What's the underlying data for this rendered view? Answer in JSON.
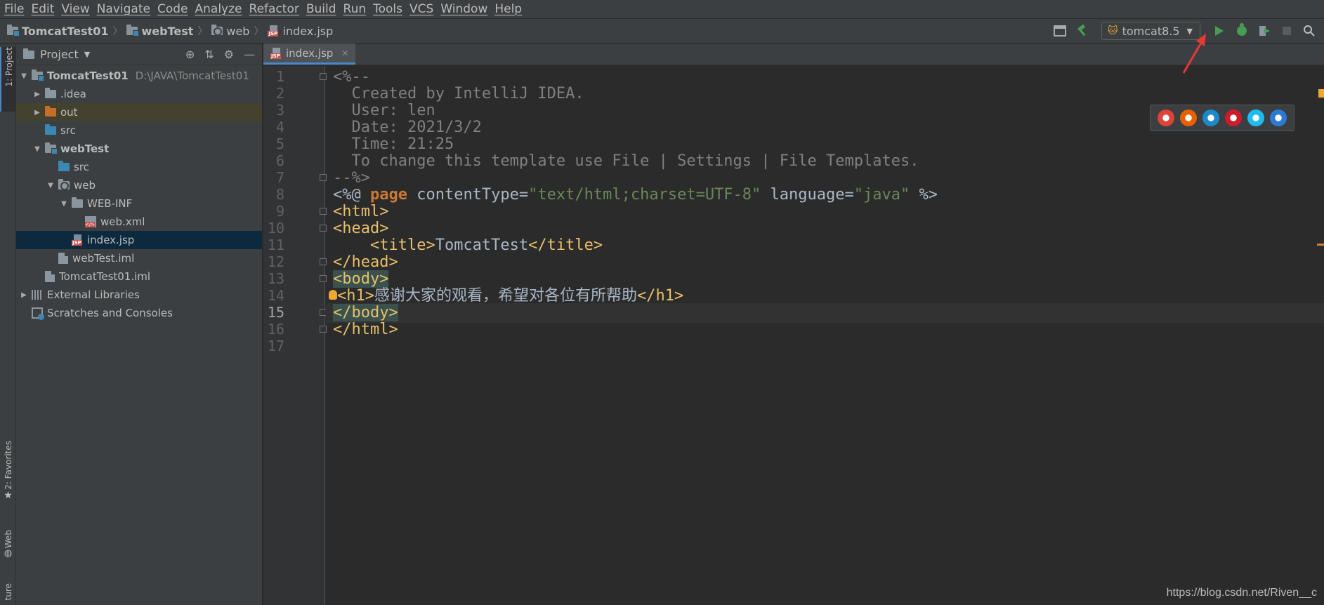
{
  "menu": [
    "File",
    "Edit",
    "View",
    "Navigate",
    "Code",
    "Analyze",
    "Refactor",
    "Build",
    "Run",
    "Tools",
    "VCS",
    "Window",
    "Help"
  ],
  "breadcrumb": {
    "project": "TomcatTest01",
    "module": "webTest",
    "folder": "web",
    "file": "index.jsp"
  },
  "toolbar": {
    "run_config": "tomcat8.5",
    "icons": [
      "project-structure-icon",
      "build-hammer-icon",
      "tomcat-icon",
      "run-icon",
      "debug-icon",
      "coverage-icon",
      "stop-icon",
      "search-icon"
    ]
  },
  "left_strip": {
    "project_tab": "1: Project",
    "favorites_tab": "2: Favorites",
    "web_tab": "Web",
    "structure_tab": "ture"
  },
  "project_panel": {
    "title": "Project",
    "tree": [
      {
        "label": "TomcatTest01",
        "path": "D:\\JAVA\\TomcatTest01",
        "level": 0,
        "expanded": true,
        "icon": "module-folder-icon",
        "bold": true
      },
      {
        "label": ".idea",
        "level": 1,
        "expanded": false,
        "icon": "folder-icon"
      },
      {
        "label": "out",
        "level": 1,
        "expanded": false,
        "icon": "excluded-folder-icon"
      },
      {
        "label": "src",
        "level": 1,
        "icon": "source-folder-icon"
      },
      {
        "label": "webTest",
        "level": 1,
        "expanded": true,
        "icon": "module-folder-icon",
        "bold": true
      },
      {
        "label": "src",
        "level": 2,
        "icon": "source-folder-icon"
      },
      {
        "label": "web",
        "level": 2,
        "expanded": true,
        "icon": "web-folder-icon"
      },
      {
        "label": "WEB-INF",
        "level": 3,
        "expanded": true,
        "icon": "folder-icon"
      },
      {
        "label": "web.xml",
        "level": 4,
        "icon": "xml-file-icon"
      },
      {
        "label": "index.jsp",
        "level": 3,
        "icon": "jsp-file-icon",
        "selected": true
      },
      {
        "label": "webTest.iml",
        "level": 2,
        "icon": "iml-file-icon"
      },
      {
        "label": "TomcatTest01.iml",
        "level": 1,
        "icon": "iml-file-icon"
      },
      {
        "label": "External Libraries",
        "level": 0,
        "expanded": false,
        "icon": "libraries-icon"
      },
      {
        "label": "Scratches and Consoles",
        "level": 0,
        "icon": "scratches-icon"
      }
    ]
  },
  "editor": {
    "tab_label": "index.jsp",
    "current_line": 15,
    "lines": [
      {
        "n": 1,
        "parts": [
          [
            "c-comment",
            "<%--"
          ]
        ]
      },
      {
        "n": 2,
        "parts": [
          [
            "c-comment",
            "  Created by IntelliJ IDEA."
          ]
        ]
      },
      {
        "n": 3,
        "parts": [
          [
            "c-comment",
            "  User: len"
          ]
        ]
      },
      {
        "n": 4,
        "parts": [
          [
            "c-comment",
            "  Date: 2021/3/2"
          ]
        ]
      },
      {
        "n": 5,
        "parts": [
          [
            "c-comment",
            "  Time: 21:25"
          ]
        ]
      },
      {
        "n": 6,
        "parts": [
          [
            "c-comment",
            "  To change this template use File | Settings | File Templates."
          ]
        ]
      },
      {
        "n": 7,
        "parts": [
          [
            "c-comment",
            "--%>"
          ]
        ]
      },
      {
        "n": 8,
        "parts": [
          [
            "c-text",
            "<%@ "
          ],
          [
            "c-kw",
            "page"
          ],
          [
            "c-text",
            " contentType="
          ],
          [
            "c-str",
            "\"text/html;charset=UTF-8\""
          ],
          [
            "c-text",
            " language="
          ],
          [
            "c-str",
            "\"java\""
          ],
          [
            "c-text",
            " %>"
          ]
        ]
      },
      {
        "n": 9,
        "parts": [
          [
            "c-tag",
            "<html>"
          ]
        ]
      },
      {
        "n": 10,
        "parts": [
          [
            "c-tag",
            "<head>"
          ]
        ]
      },
      {
        "n": 11,
        "parts": [
          [
            "c-text",
            "    "
          ],
          [
            "c-tag",
            "<title>"
          ],
          [
            "c-text",
            "TomcatTest"
          ],
          [
            "c-tag",
            "</title>"
          ]
        ]
      },
      {
        "n": 12,
        "parts": [
          [
            "c-tag",
            "</head>"
          ]
        ]
      },
      {
        "n": 13,
        "parts": [
          [
            "c-tag match-bg",
            "<body>"
          ]
        ]
      },
      {
        "n": 14,
        "parts": [
          [
            "c-tag",
            "<h1>"
          ],
          [
            "c-text",
            "感谢大家的观看，希望对各位有所帮助"
          ],
          [
            "c-tag",
            "</h1>"
          ]
        ]
      },
      {
        "n": 15,
        "parts": [
          [
            "c-tag match-bg",
            "</body>"
          ]
        ]
      },
      {
        "n": 16,
        "parts": [
          [
            "c-tag",
            "</html>"
          ]
        ]
      },
      {
        "n": 17,
        "parts": []
      }
    ],
    "fold_lines": [
      1,
      7,
      9,
      10,
      12,
      13,
      15,
      16
    ]
  },
  "browser_popup": {
    "browsers": [
      {
        "name": "chrome-icon",
        "color": "#db4437"
      },
      {
        "name": "firefox-icon",
        "color": "#e66000"
      },
      {
        "name": "safari-icon",
        "color": "#1b88ca"
      },
      {
        "name": "opera-icon",
        "color": "#cc1b2c"
      },
      {
        "name": "ie-icon",
        "color": "#1ebbee"
      },
      {
        "name": "edge-icon",
        "color": "#2b7bd4"
      }
    ]
  },
  "watermark": "https://blog.csdn.net/Riven__c",
  "colors": {
    "accent": "#4a88c7",
    "run_green": "#499c54",
    "annotation_red": "#e53935"
  }
}
